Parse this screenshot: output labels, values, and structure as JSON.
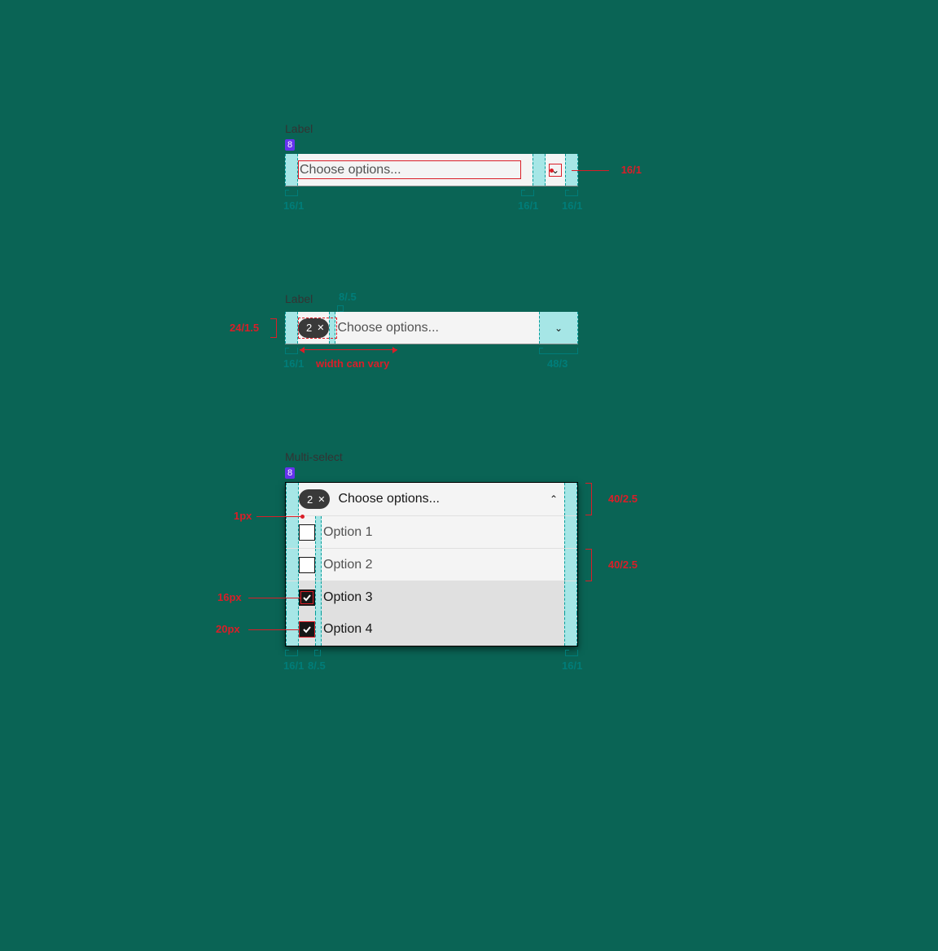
{
  "section1": {
    "label": "Label",
    "badge": "8",
    "placeholder": "Choose options...",
    "anno_right": "16/1",
    "anno_bottom": [
      "16/1",
      "16/1",
      "16/1"
    ]
  },
  "section2": {
    "label": "Label",
    "top_anno": "8/.5",
    "placeholder": "Choose options...",
    "tag_count": "2",
    "anno_left": "24/1.5",
    "anno_bottom_left": "16/1",
    "anno_bottom_mid": "width can vary",
    "anno_bottom_right": "48/3"
  },
  "section3": {
    "label": "Multi-select",
    "badge": "8",
    "placeholder": "Choose options...",
    "tag_count": "2",
    "options": [
      {
        "label": "Option 1",
        "checked": false,
        "selected": false
      },
      {
        "label": "Option 2",
        "checked": false,
        "selected": false
      },
      {
        "label": "Option 3",
        "checked": true,
        "selected": true
      },
      {
        "label": "Option 4",
        "checked": true,
        "selected": true
      }
    ],
    "anno_right_top": "40/2.5",
    "anno_right_mid": "40/2.5",
    "anno_left_1px": "1px",
    "anno_left_16px": "16px",
    "anno_left_20px": "20px",
    "anno_bottom": [
      "16/1",
      "8/.5",
      "16/1"
    ]
  }
}
